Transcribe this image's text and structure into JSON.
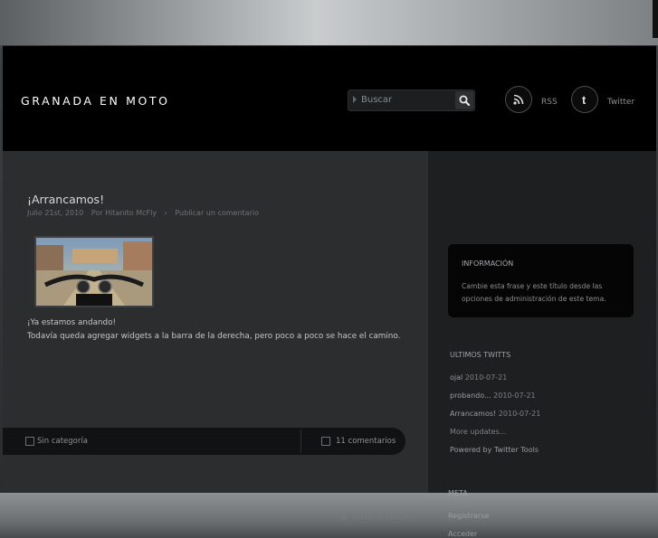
{
  "header": {
    "site_title": "GRANADA EN MOTO",
    "search_placeholder": "Buscar",
    "social": [
      {
        "label": "RSS",
        "icon": "rss-icon"
      },
      {
        "label": "Twitter",
        "icon": "twitter-icon"
      }
    ]
  },
  "post": {
    "title": "¡Arrancamos!",
    "date": "Julio 21st, 2010",
    "author": "Por Hitanito McFly",
    "comment_link": "Publicar un comentario",
    "body_line1": "¡Ya estamos andando!",
    "body_line2": "Todavía queda agregar widgets a la barra de la derecha, pero poco a poco se hace el camino.",
    "category": "Sin categoría",
    "comments": "11 comentarios"
  },
  "back_to_top": "Volver a arriba",
  "sidebar": {
    "info_title": "INFORMACIÓN",
    "info_text": "Cambie esta frase y este título desde las opciones de administración de este tema.",
    "tweets_title": "ULTIMOS TWITTS",
    "tweets": [
      {
        "text": "ojal",
        "date": "2010-07-21"
      },
      {
        "text": "probando...",
        "date": "2010-07-21"
      },
      {
        "text": "Arrancamos!",
        "date": "2010-07-21"
      }
    ],
    "more_updates": "More updates...",
    "powered_by": "Powered by",
    "powered_link": "Twitter Tools",
    "meta_title": "META",
    "meta_links": [
      "Registrarse",
      "Acceder"
    ]
  },
  "colors": {
    "accent": "#000000",
    "background": "#2b2d2f"
  }
}
